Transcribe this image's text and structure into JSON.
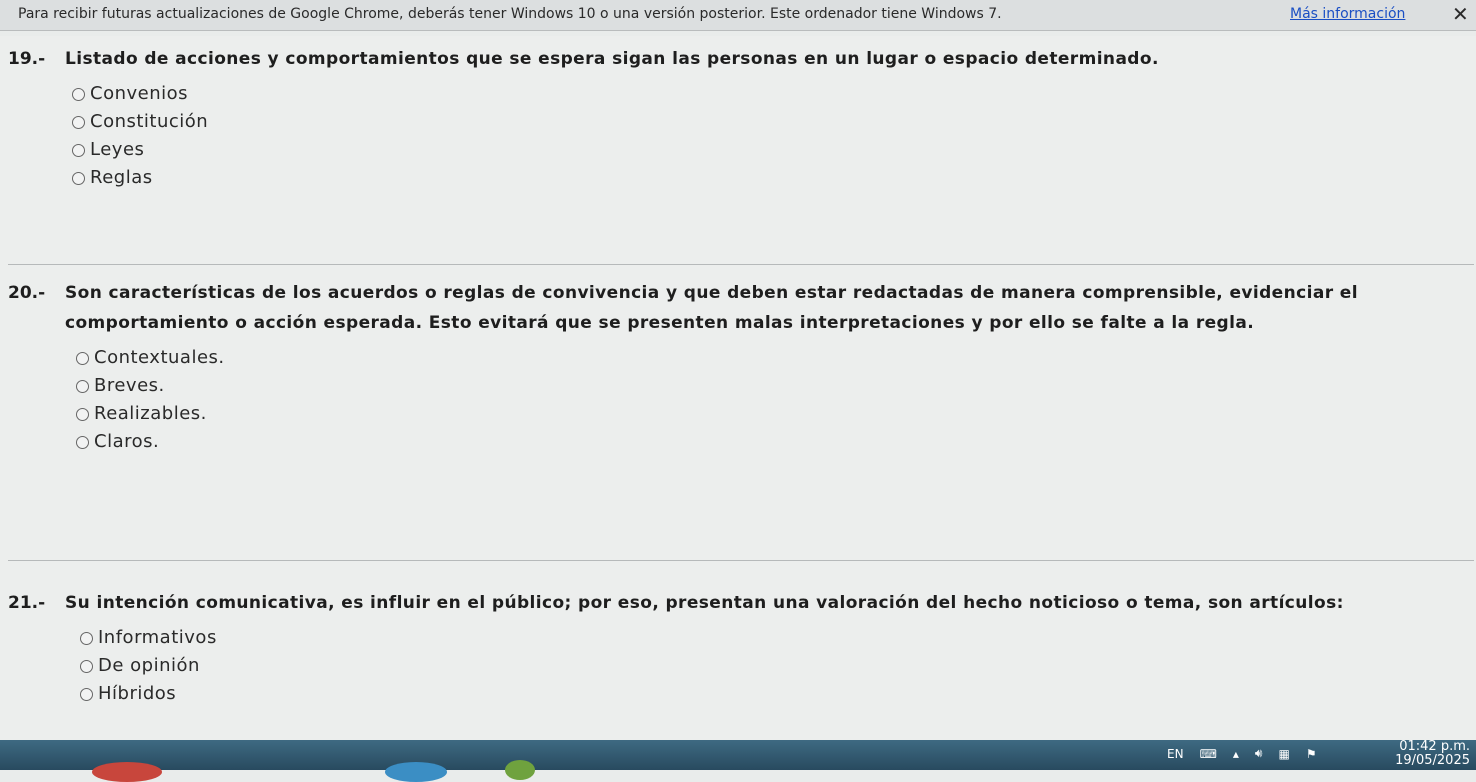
{
  "infobar": {
    "message": "Para recibir futuras actualizaciones de Google Chrome, deberás tener Windows 10 o una versión posterior. Este ordenador tiene Windows 7.",
    "more_link": "Más información",
    "close": "✕"
  },
  "questions": [
    {
      "number": "19.-",
      "text": "Listado de acciones y comportamientos que se espera sigan las personas en un lugar o espacio determinado.",
      "options": [
        "Convenios",
        "Constitución",
        "Leyes",
        "Reglas"
      ]
    },
    {
      "number": "20.-",
      "text": "Son características de los acuerdos o reglas de convivencia y que deben estar redactadas de manera comprensible, evidenciar el comportamiento o acción esperada. Esto evitará que se presenten malas interpretaciones y por ello se falte a la regla.",
      "options": [
        "Contextuales.",
        "Breves.",
        "Realizables.",
        "Claros."
      ]
    },
    {
      "number": "21.-",
      "text": "Su intención comunicativa, es influir en el público; por eso, presentan una valoración del hecho noticioso o tema, son artículos:",
      "options": [
        "Informativos",
        "De opinión",
        "Híbridos"
      ]
    }
  ],
  "taskbar": {
    "language": "EN",
    "time": "01:42 p.m.",
    "date": "19/05/2025"
  }
}
